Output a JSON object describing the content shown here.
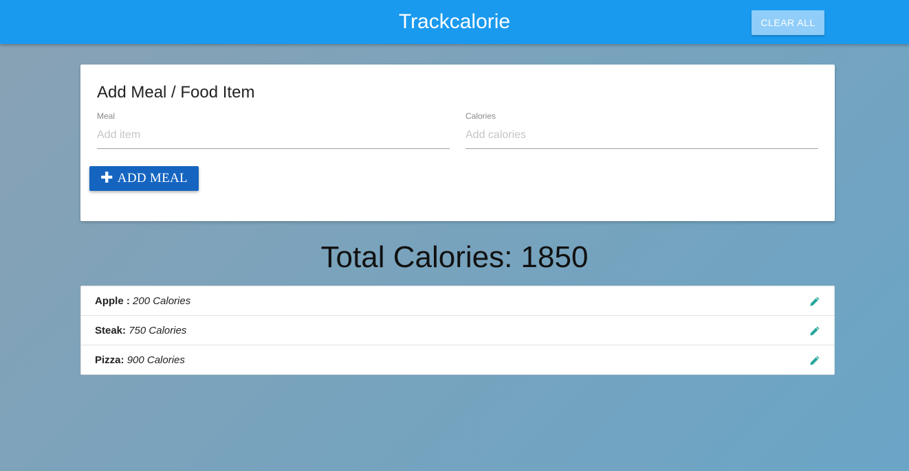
{
  "navbar": {
    "brand": "Trackcalorie",
    "clear_all_label": "CLEAR ALL"
  },
  "form": {
    "title": "Add Meal / Food Item",
    "meal_label": "Meal",
    "meal_placeholder": "Add item",
    "meal_value": "",
    "calories_label": "Calories",
    "calories_placeholder": "Add calories",
    "calories_value": "",
    "add_button_label": "ADD MEAL",
    "add_button_icon": "plus-icon"
  },
  "total": {
    "text": "Total Calories: 1850"
  },
  "items": [
    {
      "name": "Apple :",
      "calories": "200 Calories",
      "icon": "pencil-icon"
    },
    {
      "name": "Steak:",
      "calories": "750 Calories",
      "icon": "pencil-icon"
    },
    {
      "name": "Pizza:",
      "calories": "900 Calories",
      "icon": "pencil-icon"
    }
  ],
  "colors": {
    "navbar": "#1a9aef",
    "add_button": "#1565c0",
    "edit_icon": "#26a69a"
  }
}
